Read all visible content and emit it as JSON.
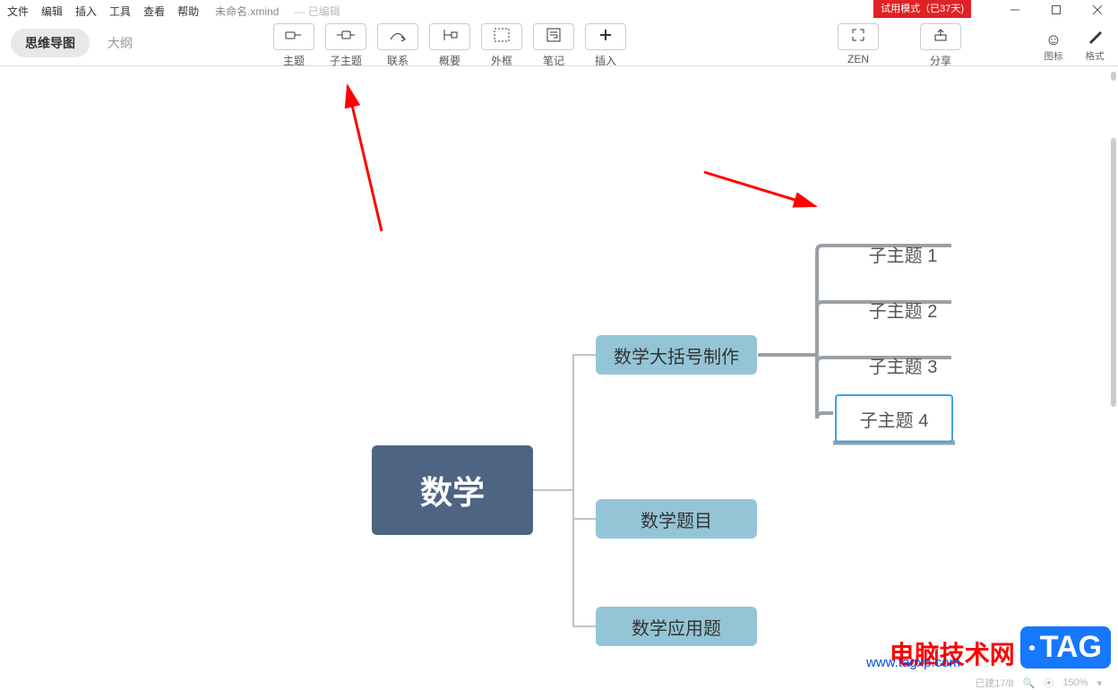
{
  "menu": {
    "file": "文件",
    "edit": "编辑",
    "insert": "插入",
    "tool": "工具",
    "view": "查看",
    "help": "帮助",
    "doc": "未命名.xmind",
    "edited": "— 已编辑"
  },
  "trial": "试用模式（已37天)",
  "view_toggle": {
    "mindmap": "思维导图",
    "outline": "大纲"
  },
  "tools": {
    "topic": "主题",
    "sub": "子主题",
    "relation": "联系",
    "summary": "概要",
    "boundary": "外框",
    "note": "笔记",
    "add": "插入",
    "zen": "ZEN",
    "share": "分享",
    "icons": "图标",
    "format": "格式"
  },
  "mindmap": {
    "central": "数学",
    "topics": [
      "数学大括号制作",
      "数学题目",
      "数学应用题"
    ],
    "subtopics": [
      "子主题 1",
      "子主题 2",
      "子主题 3",
      "子主题 4"
    ]
  },
  "status": {
    "count": "已建17/8",
    "zoom": "150%"
  },
  "watermark": {
    "site": "电脑技术网",
    "url": "www.tagxp.com",
    "tag": "TAG"
  }
}
